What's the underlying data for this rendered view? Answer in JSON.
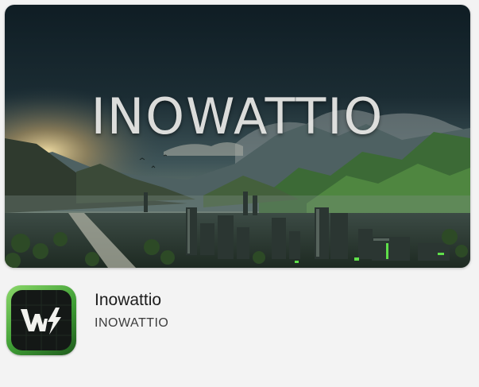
{
  "banner": {
    "title": "INOWATTIO"
  },
  "app": {
    "name": "Inowattio",
    "developer": "INOWATTIO",
    "icon": "inowattio-ws-bolt-logo",
    "colors": {
      "icon_frame": "#4caf3f",
      "icon_background": "#141816"
    }
  }
}
